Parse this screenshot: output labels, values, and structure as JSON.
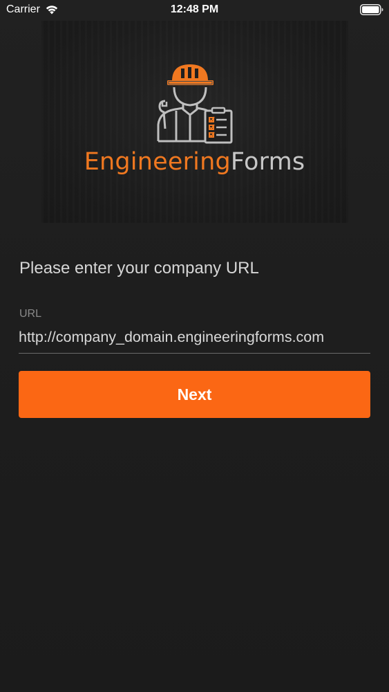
{
  "status_bar": {
    "carrier": "Carrier",
    "time": "12:48 PM",
    "wifi_icon": "wifi-icon",
    "battery_icon": "battery-full-icon"
  },
  "logo": {
    "icon": "engineer-with-clipboard-icon",
    "brand_part1": "Engineering",
    "brand_part2": "Forms",
    "accent_color": "#f07820",
    "secondary_color": "#c7c7c7"
  },
  "form": {
    "prompt": "Please enter your company URL",
    "url_label": "URL",
    "url_value": "http://company_domain.engineeringforms.com",
    "next_label": "Next",
    "button_color": "#fb6714"
  }
}
